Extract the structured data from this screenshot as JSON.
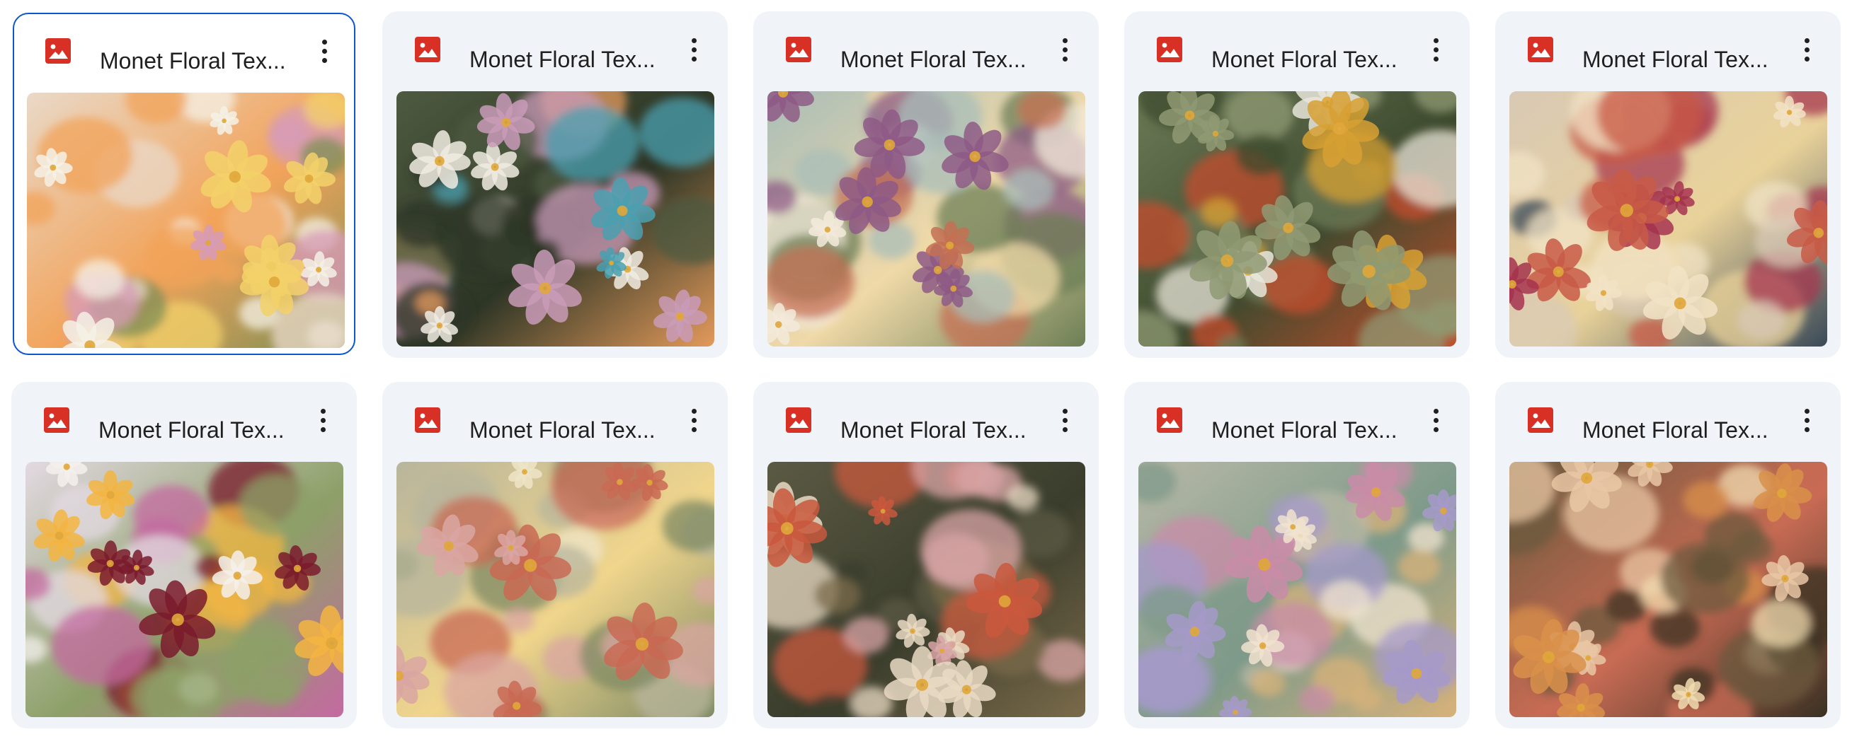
{
  "files": [
    {
      "title": "Monet Floral Tex...",
      "selected": true,
      "palette": [
        "#e9d9c8",
        "#f5f1e6",
        "#f3d16a",
        "#d79bb8",
        "#7d8f55",
        "#f2a35a"
      ]
    },
    {
      "title": "Monet Floral Tex...",
      "selected": false,
      "palette": [
        "#4e5a40",
        "#f1ece2",
        "#c99bb9",
        "#4aa0b0",
        "#e39a5b",
        "#2d3525"
      ]
    },
    {
      "title": "Monet Floral Tex...",
      "selected": false,
      "palette": [
        "#a9bdb8",
        "#f3eadb",
        "#c47054",
        "#8e5b86",
        "#6d7f55",
        "#f0d9a8"
      ]
    },
    {
      "title": "Monet Floral Tex...",
      "selected": false,
      "palette": [
        "#6c7a57",
        "#8f9a73",
        "#d7a032",
        "#e9e6da",
        "#c44d2c",
        "#3e4a2e"
      ]
    },
    {
      "title": "Monet Floral Tex...",
      "selected": false,
      "palette": [
        "#d9c9b5",
        "#f2e3c6",
        "#c85a46",
        "#a5344f",
        "#3b4a58",
        "#e9d29a"
      ]
    },
    {
      "title": "Monet Floral Tex...",
      "selected": false,
      "palette": [
        "#e3d9e2",
        "#7a1b2d",
        "#f3b541",
        "#f4f0ec",
        "#c46aa0",
        "#8da068"
      ]
    },
    {
      "title": "Monet Floral Tex...",
      "selected": false,
      "palette": [
        "#b8b59c",
        "#efe5c8",
        "#c96a54",
        "#d9a6a2",
        "#7d8a64",
        "#f0d58c"
      ]
    },
    {
      "title": "Monet Floral Tex...",
      "selected": false,
      "palette": [
        "#5b5a44",
        "#eadbc4",
        "#c9583d",
        "#d8a4a6",
        "#7a6a4a",
        "#3a3d2c"
      ]
    },
    {
      "title": "Monet Floral Tex...",
      "selected": false,
      "palette": [
        "#b8b8a6",
        "#f0e3cf",
        "#c98ca8",
        "#a69ac9",
        "#d7b27a",
        "#7e9a8a"
      ]
    },
    {
      "title": "Monet Floral Tex...",
      "selected": false,
      "palette": [
        "#6b5a3d",
        "#f2dcb0",
        "#d9904a",
        "#e9c7a4",
        "#3a3124",
        "#c86b54"
      ]
    }
  ],
  "colors": {
    "card_background": "#f0f4f9",
    "selected_border": "#0b57d0",
    "image_icon": "#d93025",
    "text": "#1f1f1f"
  },
  "icons": {
    "file_type": "image-file-icon",
    "menu": "more-vert-icon"
  }
}
